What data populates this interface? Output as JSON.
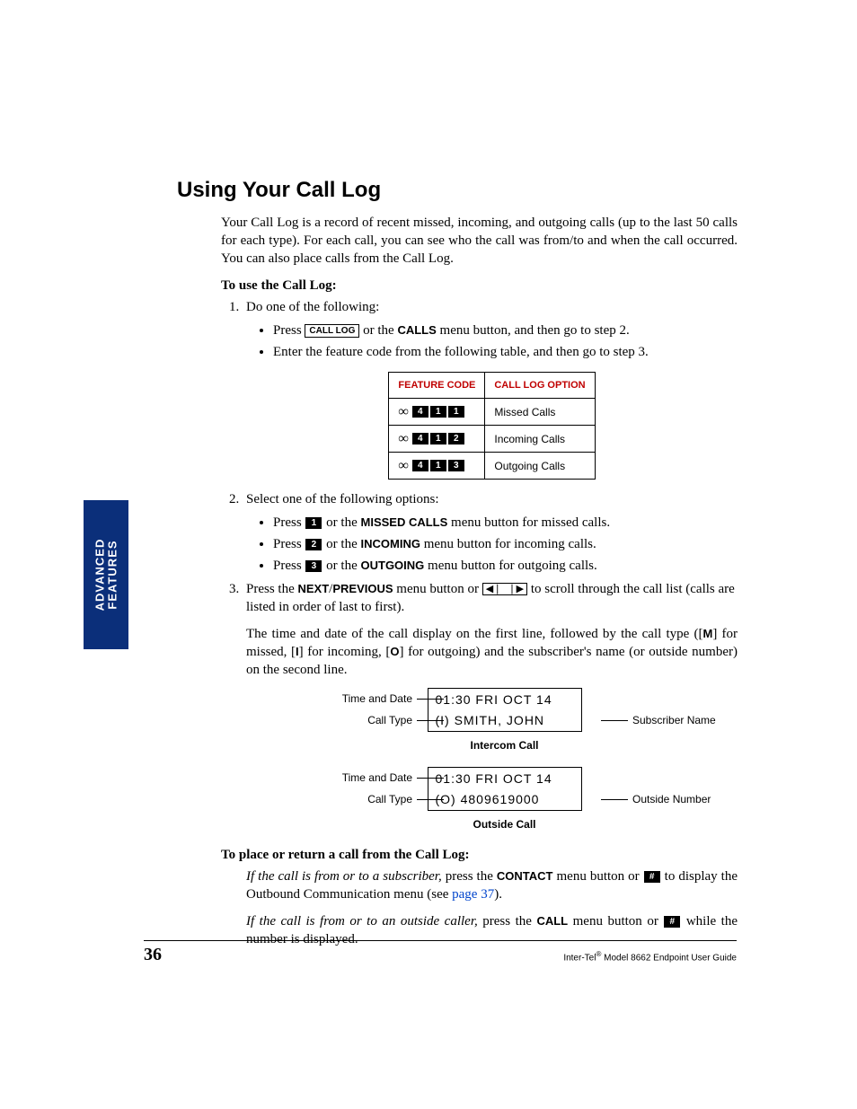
{
  "side_tab": {
    "line1": "ADVANCED",
    "line2": "FEATURES"
  },
  "title": "Using Your Call Log",
  "intro": "Your Call Log is a record of recent missed, incoming, and outgoing calls (up to the last 50 calls for each type). For each call, you can see who the call was from/to and when the call occurred. You can also place calls from the Call Log.",
  "to_use_heading": "To use the Call Log:",
  "step1_lead": "Do one of the following:",
  "step1_b1_pre": "Press ",
  "step1_b1_key": "CALL LOG",
  "step1_b1_mid": " or the ",
  "step1_b1_btn": "CALLS",
  "step1_b1_post": " menu button, and then go to step 2.",
  "step1_b2": "Enter the feature code from the following table, and then go to step 3.",
  "table": {
    "h1": "FEATURE CODE",
    "h2": "CALL LOG OPTION",
    "rows": [
      {
        "keys": [
          "4",
          "1",
          "1"
        ],
        "label": "Missed Calls"
      },
      {
        "keys": [
          "4",
          "1",
          "2"
        ],
        "label": "Incoming Calls"
      },
      {
        "keys": [
          "4",
          "1",
          "3"
        ],
        "label": "Outgoing Calls"
      }
    ]
  },
  "step2_lead": "Select one of the following options:",
  "step2_b1": {
    "pre": "Press ",
    "k": "1",
    "mid": " or the ",
    "btn": "MISSED CALLS",
    "post": " menu button for missed calls."
  },
  "step2_b2": {
    "pre": "Press ",
    "k": "2",
    "mid": " or the ",
    "btn": "INCOMING",
    "post": " menu button for incoming calls."
  },
  "step2_b3": {
    "pre": "Press ",
    "k": "3",
    "mid": " or the ",
    "btn": "OUTGOING",
    "post": " menu button for outgoing calls."
  },
  "step3_pre": "Press the ",
  "step3_next": "NEXT",
  "step3_slash": "/",
  "step3_prev": "PREVIOUS",
  "step3_mid": " menu button or ",
  "step3_post": " to scroll through the call list (calls are listed in order of last to first).",
  "step3_para2a": "The time and date of the call display on the first line, followed by the call type ([",
  "step3_M": "M",
  "step3_para2b": "] for missed, [",
  "step3_I": "I",
  "step3_para2c": "] for incoming, [",
  "step3_O": "O",
  "step3_para2d": "] for outgoing) and the subscriber's name (or outside number) on the second line.",
  "lcd1": {
    "left1": "Time and Date",
    "right1": "",
    "line1": "01:30  FRI  OCT 14",
    "left2": "Call Type",
    "right2": "Subscriber Name",
    "line2": "(I) SMITH, JOHN",
    "caption": "Intercom Call"
  },
  "lcd2": {
    "left1": "Time and Date",
    "right1": "",
    "line1": "01:30  FRI  OCT 14",
    "left2": "Call Type",
    "right2": "Outside Number",
    "line2": "(O) 4809619000",
    "caption": "Outside Call"
  },
  "place_heading": "To place or return a call from the Call Log:",
  "place_p1_it": "If the call is from or to a subscriber,",
  "place_p1_a": " press the ",
  "place_p1_btn": "CONTACT",
  "place_p1_b": " menu button or ",
  "place_p1_key": "#",
  "place_p1_c": " to display the Outbound Communication menu (see ",
  "place_p1_link": "page 37",
  "place_p1_d": ").",
  "place_p2_it": "If the call is from or to an outside caller,",
  "place_p2_a": " press the ",
  "place_p2_btn": "CALL",
  "place_p2_b": " menu button or ",
  "place_p2_key": "#",
  "place_p2_c": " while the number is displayed.",
  "footer": {
    "page": "36",
    "text_pre": "Inter-Tel",
    "text_sup": "®",
    "text_post": " Model 8662 Endpoint User Guide"
  }
}
